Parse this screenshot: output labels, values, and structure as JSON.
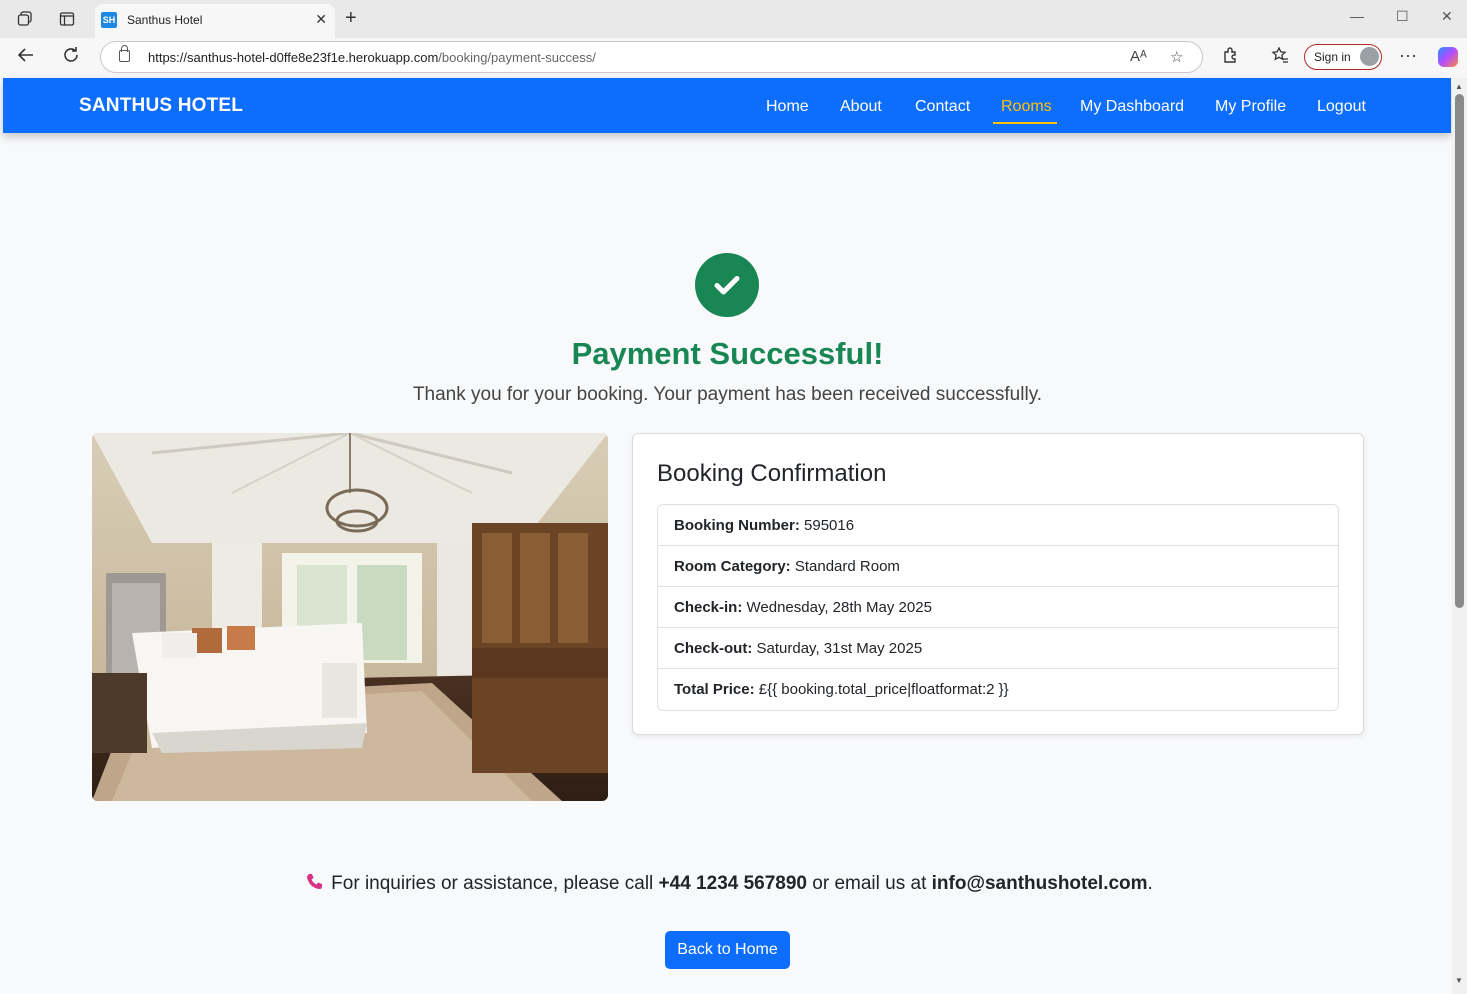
{
  "browser": {
    "tab_title": "Santhus Hotel",
    "tab_favicon": "SH",
    "url_host": "https://santhus-hotel-d0ffe8e23f1e.herokuapp.com",
    "url_path": "/booking/payment-success/",
    "sign_in_label": "Sign in"
  },
  "navbar": {
    "brand": "SANTHUS HOTEL",
    "links": [
      "Home",
      "About",
      "Contact",
      "Rooms",
      "My Dashboard",
      "My Profile",
      "Logout"
    ],
    "active": "Rooms",
    "accent_color": "#ffc107",
    "bg_color": "#0d6efd"
  },
  "success": {
    "icon": "check-circle-icon",
    "title": "Payment Successful!",
    "lead": "Thank you for your booking. Your payment has been received successfully.",
    "color": "#198754"
  },
  "confirmation": {
    "title": "Booking Confirmation",
    "items": [
      {
        "label": "Booking Number:",
        "value": "595016"
      },
      {
        "label": "Room Category:",
        "value": "Standard Room"
      },
      {
        "label": "Check-in:",
        "value": "Wednesday, 28th May 2025"
      },
      {
        "label": "Check-out:",
        "value": "Saturday, 31st May 2025"
      },
      {
        "label": "Total Price:",
        "value": "£{{ booking.total_price|floatformat:2 }}"
      }
    ]
  },
  "contact": {
    "prefix": "For inquiries or assistance, please call",
    "phone": "+44 1234 567890",
    "middle": "or email us at",
    "email": "info@santhushotel.com",
    "suffix": "."
  },
  "back_button": "Back to Home"
}
